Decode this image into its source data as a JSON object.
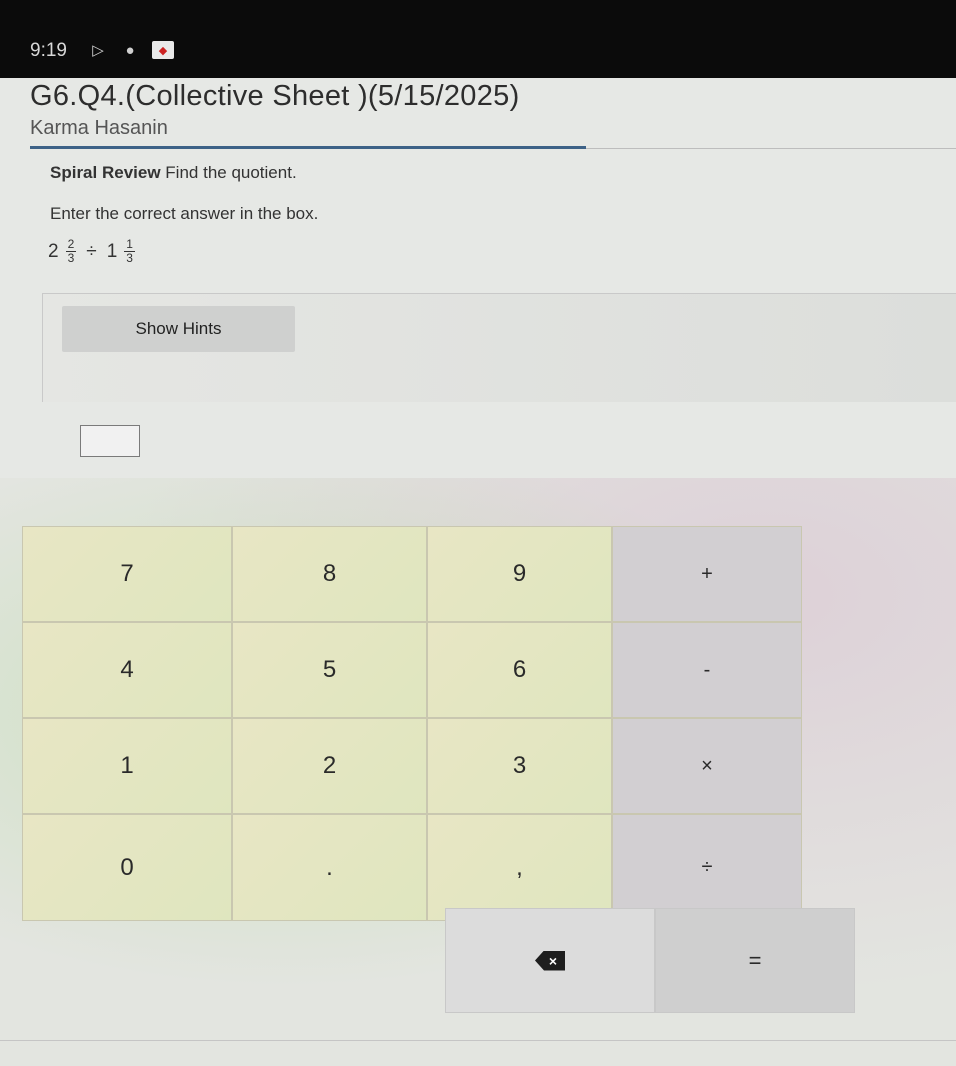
{
  "status_bar": {
    "time": "9:19",
    "icons": [
      "play-icon",
      "circle-icon",
      "notification-icon"
    ]
  },
  "header": {
    "title": "G6.Q4.(Collective Sheet )(5/15/2025)",
    "student": "Karma Hasanin"
  },
  "question": {
    "label": "Spiral Review",
    "prompt": "Find the quotient.",
    "instructions": "Enter the correct answer in the box.",
    "expression": {
      "whole1": "2",
      "num1": "2",
      "den1": "3",
      "operator": "÷",
      "whole2": "1",
      "num2": "1",
      "den2": "3"
    }
  },
  "hints": {
    "button_label": "Show Hints"
  },
  "answer": {
    "value": ""
  },
  "keypad": {
    "row1": [
      "7",
      "8",
      "9",
      "+"
    ],
    "row2": [
      "4",
      "5",
      "6",
      "-"
    ],
    "row3": [
      "1",
      "2",
      "3",
      "×"
    ],
    "row4": [
      "0",
      ".",
      ",",
      "÷"
    ],
    "equals": "=",
    "delete_icon": "backspace-icon"
  },
  "colors": {
    "accent_rule": "#3d6287",
    "key_number_bg": "#ebeac8",
    "key_operator_bg": "#d2cfd2"
  }
}
